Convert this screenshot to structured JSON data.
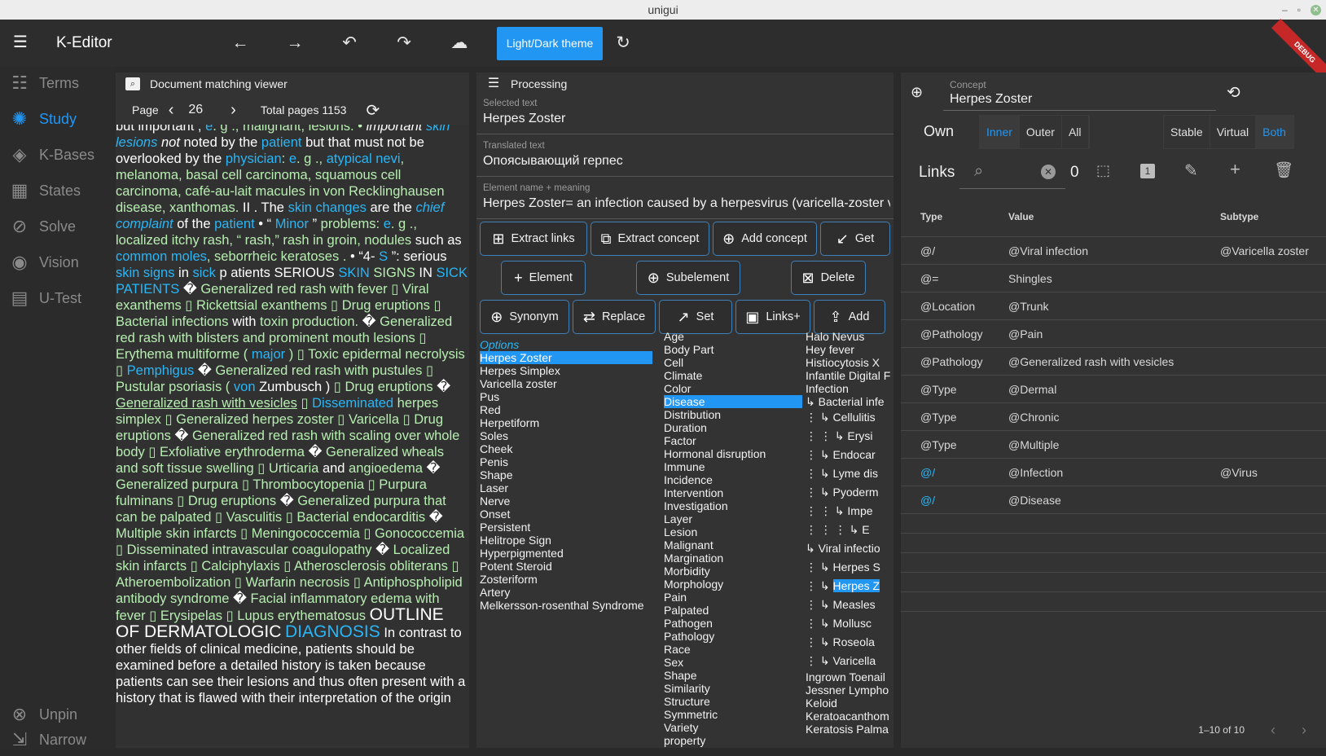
{
  "window": {
    "title": "unigui"
  },
  "app": {
    "title": "K-Editor",
    "theme_button": "Light/Dark theme"
  },
  "sidebar": {
    "items": [
      {
        "label": "Terms",
        "icon": "list-icon"
      },
      {
        "label": "Study",
        "icon": "sun-icon",
        "active": true
      },
      {
        "label": "K-Bases",
        "icon": "layers-icon"
      },
      {
        "label": "States",
        "icon": "grid-icon"
      },
      {
        "label": "Solve",
        "icon": "compass-icon"
      },
      {
        "label": "Vision",
        "icon": "eye-icon"
      },
      {
        "label": "U-Test",
        "icon": "chat-icon"
      }
    ],
    "bottom": [
      {
        "label": "Unpin",
        "icon": "link-off-icon"
      },
      {
        "label": "Narrow",
        "icon": "compress-icon"
      }
    ]
  },
  "left_panel": {
    "title": "Document matching viewer",
    "page_label": "Page",
    "page": "26",
    "total_pages": "Total pages 1153"
  },
  "middle_panel": {
    "title": "Processing",
    "selected_text": {
      "label": "Selected text",
      "value": "Herpes Zoster"
    },
    "translated_text": {
      "label": "Translated text",
      "value": "Опоясывающий герпес"
    },
    "element": {
      "label": "Element name + meaning",
      "value": "Herpes Zoster= an infection caused by a herpesvirus (varicella-zoster v"
    },
    "buttons": [
      "Extract links",
      "Extract concept",
      "Add concept",
      "Get",
      "Element",
      "Subelement",
      "Delete",
      "Synonym",
      "Replace",
      "Set",
      "Links+",
      "Add"
    ],
    "col1_header": "Options",
    "col1": [
      "Herpes Zoster",
      "Herpes Simplex",
      "Varicella zoster",
      "Pus",
      "Red",
      "Herpetiform",
      "Soles",
      "Cheek",
      "Penis",
      "Shape",
      "Laser",
      "Nerve",
      "Onset",
      "Persistent",
      "Helitrope Sign",
      "Hyperpigmented",
      "Potent Steroid",
      "Zosteriform",
      "Artery",
      "Melkersson-rosenthal Syndrome"
    ],
    "col2_top": "Age",
    "col2": [
      "Body Part",
      "Cell",
      "Climate",
      "Color",
      "Disease",
      "Distribution",
      "Duration",
      "Factor",
      "Hormonal disruption",
      "Immune",
      "Incidence",
      "Intervention",
      "Investigation",
      "Layer",
      "Lesion",
      "Malignant",
      "Margination",
      "Morbidity",
      "Morphology",
      "Pain",
      "Palpated",
      "Pathogen",
      "Pathology",
      "Race",
      "Sex",
      "Shape",
      "Similarity",
      "Structure",
      "Symmetric",
      "Variety",
      "property"
    ],
    "col3_top": "Halo Nevus",
    "col3": [
      "Hey fever",
      "Histiocytosis X",
      "Infantile Digital F",
      "Infection",
      "↳ Bacterial infe",
      "⋮ ↳ Cellulitis",
      "⋮ ⋮ ↳ Erysi",
      "⋮ ↳ Endocar",
      "⋮ ↳ Lyme dis",
      "⋮ ↳ Pyoderm",
      "⋮ ⋮ ↳ Impe",
      "⋮ ⋮ ⋮ ↳ E",
      "↳ Viral infectio",
      "⋮ ↳ Herpes S",
      "⋮ ↳ Herpes Z",
      "⋮ ↳ Measles",
      "⋮ ↳ Mollusc",
      "⋮ ↳ Roseola",
      "⋮ ↳ Varicella",
      "Ingrown Toenail",
      "Jessner Lympho",
      "Keloid",
      "Keratoacanthom",
      "Keratosis Palma"
    ]
  },
  "right_panel": {
    "concept": {
      "label": "Concept",
      "value": "Herpes Zoster"
    },
    "scope": [
      "Own",
      "Inner",
      "Outer",
      "All"
    ],
    "mode": [
      "Stable",
      "Virtual",
      "Both"
    ],
    "links_label": "Links",
    "links_count": "0",
    "columns": [
      "Type",
      "Value",
      "Subtype"
    ],
    "rows": [
      {
        "type": "@/",
        "value": "@Viral infection",
        "subtype": "@Varicella zoster"
      },
      {
        "type": "@=",
        "value": "Shingles",
        "subtype": ""
      },
      {
        "type": "@Location",
        "value": "@Trunk",
        "subtype": ""
      },
      {
        "type": "@Pathology",
        "value": "@Pain",
        "subtype": ""
      },
      {
        "type": "@Pathology",
        "value": "@Generalized rash with vesicles",
        "subtype": ""
      },
      {
        "type": "@Type",
        "value": "@Dermal",
        "subtype": ""
      },
      {
        "type": "@Type",
        "value": "@Chronic",
        "subtype": ""
      },
      {
        "type": "@Type",
        "value": "@Multiple",
        "subtype": ""
      },
      {
        "type": "@/",
        "value": "@Infection",
        "subtype": "@Virus"
      },
      {
        "type": "@/",
        "value": "@Disease",
        "subtype": ""
      }
    ],
    "pagination": "1–10 of 10"
  },
  "colors": {
    "accent": "#2196f3",
    "link": "#29b6f6",
    "doc_text": "#b7eeb1",
    "background": "#2a2a2a",
    "panel": "#333333"
  }
}
